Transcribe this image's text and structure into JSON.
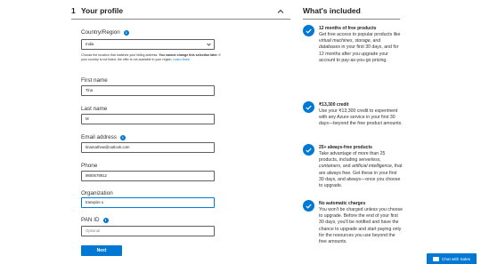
{
  "profile": {
    "step_number": "1",
    "title": "Your profile",
    "country": {
      "label": "Country/Region",
      "value": "India",
      "help_prefix": "Choose the location that matches your billing address. ",
      "help_bold": "You cannot change this selection later.",
      "help_suffix": " If your country is not listed, the offer is not available in your region. ",
      "help_link": "Learn More"
    },
    "first_name": {
      "label": "First name",
      "value": "Tina"
    },
    "last_name": {
      "label": "Last name",
      "value": "M"
    },
    "email": {
      "label": "Email address",
      "value": "tinamathew@outlook.com"
    },
    "phone": {
      "label": "Phone",
      "value": "9800578912"
    },
    "organization": {
      "label": "Organization",
      "value": "transpire s"
    },
    "pan": {
      "label": "PAN ID",
      "placeholder": "Optional"
    },
    "next_label": "Next"
  },
  "included": {
    "title": "What's included",
    "benefits": [
      {
        "title": "12 months of free products",
        "body_parts": [
          {
            "t": "Get free access to popular products like ",
            "i": false
          },
          {
            "t": "virtual machines, storage,",
            "i": true
          },
          {
            "t": " and ",
            "i": false
          },
          {
            "t": "databases",
            "i": true
          },
          {
            "t": " in your first 30 days, and for 12 months after you upgrade your account to pay-as-you-go pricing.",
            "i": false
          }
        ]
      },
      {
        "title": "₹13,300 credit",
        "body_parts": [
          {
            "t": "Use your ₹13,300 credit to experiment with any Azure service in your first 30 days—beyond the free product amounts.",
            "i": false
          }
        ]
      },
      {
        "title": "25+ always-free products",
        "body_parts": [
          {
            "t": "Take advantage of more than 25 products, including ",
            "i": false
          },
          {
            "t": "serverless, containers,",
            "i": true
          },
          {
            "t": " and ",
            "i": false
          },
          {
            "t": "artificial intelligence,",
            "i": true
          },
          {
            "t": " that are always free. Get these in your first 30 days, and always—once you choose to upgrade.",
            "i": false
          }
        ]
      },
      {
        "title": "No automatic charges",
        "body_parts": [
          {
            "t": "You won't be charged unless you choose to upgrade. Before the end of your first 30 days, you'll be notified and have the chance to upgrade and start paying only for the resources you use beyond the free amounts.",
            "i": false
          }
        ]
      }
    ]
  },
  "chat": {
    "label": "Chat with Sales"
  },
  "colors": {
    "accent": "#0078d4",
    "text": "#201f1e",
    "border": "#605e5c"
  },
  "icons": {
    "info": "info-icon",
    "check": "check-icon",
    "collapse": "chevron-up-icon",
    "chat": "chat-icon"
  }
}
